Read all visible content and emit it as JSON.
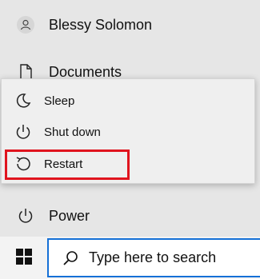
{
  "start_menu": {
    "user": {
      "name": "Blessy Solomon",
      "icon": "user-avatar-icon"
    },
    "documents": {
      "label": "Documents",
      "icon": "document-icon"
    },
    "power": {
      "label": "Power",
      "icon": "power-icon"
    }
  },
  "power_menu": {
    "items": [
      {
        "label": "Sleep",
        "icon": "moon-icon"
      },
      {
        "label": "Shut down",
        "icon": "power-icon"
      },
      {
        "label": "Restart",
        "icon": "restart-icon",
        "highlighted": true
      }
    ],
    "highlight_color": "#e0141e"
  },
  "taskbar": {
    "start_icon": "windows-logo-icon",
    "search": {
      "placeholder": "Type here to search",
      "icon": "search-icon",
      "border_color": "#1570d6"
    }
  }
}
